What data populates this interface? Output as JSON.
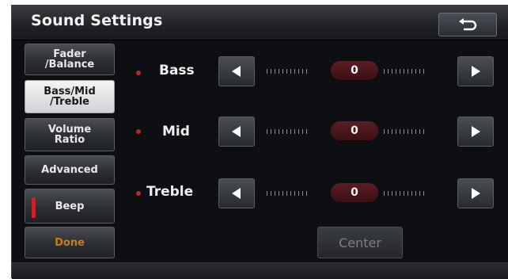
{
  "header": {
    "title": "Sound Settings",
    "back_icon": "return-arrow-icon"
  },
  "menu": {
    "fader_balance": "Fader\n/Balance",
    "bass_mid_treble": "Bass/Mid\n/Treble",
    "volume_ratio": "Volume\nRatio",
    "advanced": "Advanced",
    "beep": "Beep",
    "done": "Done"
  },
  "controls": {
    "bass": {
      "label": "Bass",
      "value": "0"
    },
    "mid": {
      "label": "Mid",
      "value": "0"
    },
    "treble": {
      "label": "Treble",
      "value": "0"
    }
  },
  "center_label": "Center",
  "colors": {
    "accent_red": "#c6232b",
    "done_orange": "#c47d1c"
  }
}
